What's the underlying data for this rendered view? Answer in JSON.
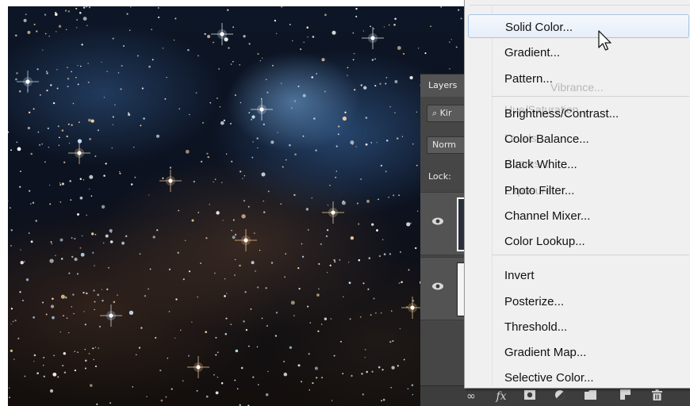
{
  "layers_panel": {
    "tab_label": "Layers",
    "search_text": "Kir",
    "blend_mode": "Norm",
    "lock_label": "Lock:",
    "bottom_icons": [
      "link-icon",
      "fx-icon",
      "mask-icon",
      "adjustment-icon",
      "folder-icon",
      "new-layer-icon",
      "trash-icon"
    ],
    "fx_label": "fx"
  },
  "adjustments_menu": {
    "group1": [
      "Solid Color...",
      "Gradient...",
      "Pattern..."
    ],
    "group2": [
      "Brightness/Contrast...",
      "Color Balance...",
      "Black White...",
      "Photo Filter...",
      "Channel Mixer...",
      "Color Lookup..."
    ],
    "group3": [
      "Invert",
      "Posterize...",
      "Threshold...",
      "Gradient Map...",
      "Selective Color..."
    ],
    "hovered_item": "Solid Color...",
    "ghost_text": {
      "vibrance": "Vibrance...",
      "huesat": "Hue/Saturation...",
      "levels": "Levels...",
      "curves": "Curves...",
      "exposure": "Exposure..."
    }
  },
  "colors": {
    "menu_bg": "#f0f0f0",
    "hover_border": "#a8c4e4",
    "panel_bg": "#464646"
  }
}
